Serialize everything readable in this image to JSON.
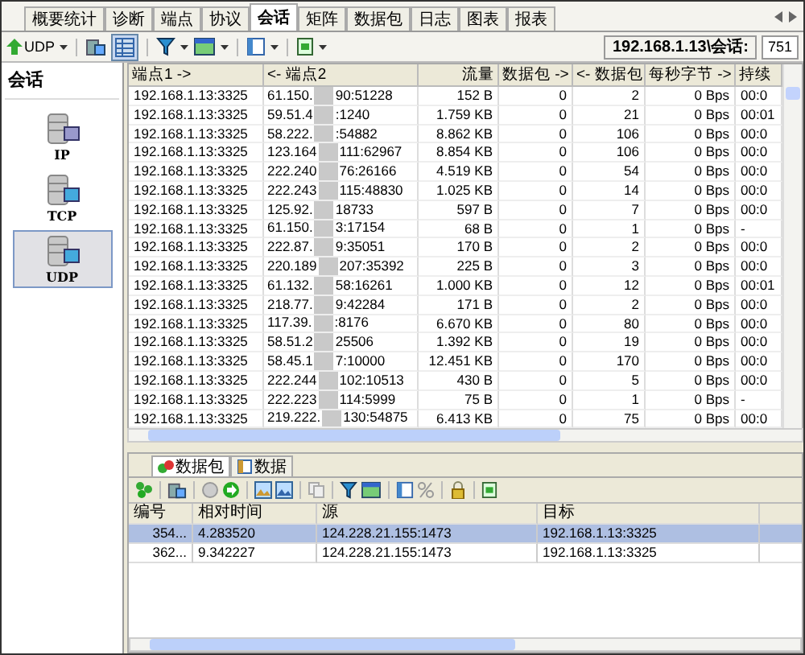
{
  "tabs": [
    {
      "label": "概要统计",
      "selected": false
    },
    {
      "label": "诊断",
      "selected": false
    },
    {
      "label": "端点",
      "selected": false
    },
    {
      "label": "协议",
      "selected": false
    },
    {
      "label": "会话",
      "selected": true
    },
    {
      "label": "矩阵",
      "selected": false
    },
    {
      "label": "数据包",
      "selected": false
    },
    {
      "label": "日志",
      "selected": false
    },
    {
      "label": "图表",
      "selected": false
    },
    {
      "label": "报表",
      "selected": false
    }
  ],
  "toolbar": {
    "protocol_button": "UDP"
  },
  "address": {
    "label": "192.168.1.13\\会话:",
    "count": "751"
  },
  "sidebar": {
    "title": "会话",
    "items": [
      {
        "label": "IP",
        "selected": false
      },
      {
        "label": "TCP",
        "selected": false
      },
      {
        "label": "UDP",
        "selected": true
      }
    ]
  },
  "table": {
    "columns": [
      "端点1 ->",
      "<- 端点2",
      "流量",
      "数据包 ->",
      "<- 数据包",
      "每秒字节 ->",
      "持续"
    ],
    "rows": [
      {
        "a": "192.168.1.13:3325",
        "b1": "61.150.",
        "b2": "90:51228",
        "t": "152 B",
        "po": "0",
        "pi": "2",
        "bps": "0 Bps",
        "d": "00:0"
      },
      {
        "a": "192.168.1.13:3325",
        "b1": "59.51.4",
        "b2": ":1240",
        "t": "1.759 KB",
        "po": "0",
        "pi": "21",
        "bps": "0 Bps",
        "d": "00:01"
      },
      {
        "a": "192.168.1.13:3325",
        "b1": "58.222.",
        "b2": ":54882",
        "t": "8.862 KB",
        "po": "0",
        "pi": "106",
        "bps": "0 Bps",
        "d": "00:0"
      },
      {
        "a": "192.168.1.13:3325",
        "b1": "123.164",
        "b2": "111:62967",
        "t": "8.854 KB",
        "po": "0",
        "pi": "106",
        "bps": "0 Bps",
        "d": "00:0"
      },
      {
        "a": "192.168.1.13:3325",
        "b1": "222.240",
        "b2": "76:26166",
        "t": "4.519 KB",
        "po": "0",
        "pi": "54",
        "bps": "0 Bps",
        "d": "00:0"
      },
      {
        "a": "192.168.1.13:3325",
        "b1": "222.243",
        "b2": "115:48830",
        "t": "1.025 KB",
        "po": "0",
        "pi": "14",
        "bps": "0 Bps",
        "d": "00:0"
      },
      {
        "a": "192.168.1.13:3325",
        "b1": "125.92.",
        "b2": "18733",
        "t": "597 B",
        "po": "0",
        "pi": "7",
        "bps": "0 Bps",
        "d": "00:0"
      },
      {
        "a": "192.168.1.13:3325",
        "b1": "61.150.",
        "b2": "3:17154",
        "t": "68 B",
        "po": "0",
        "pi": "1",
        "bps": "0 Bps",
        "d": "-"
      },
      {
        "a": "192.168.1.13:3325",
        "b1": "222.87.",
        "b2": "9:35051",
        "t": "170 B",
        "po": "0",
        "pi": "2",
        "bps": "0 Bps",
        "d": "00:0"
      },
      {
        "a": "192.168.1.13:3325",
        "b1": "220.189",
        "b2": "207:35392",
        "t": "225 B",
        "po": "0",
        "pi": "3",
        "bps": "0 Bps",
        "d": "00:0"
      },
      {
        "a": "192.168.1.13:3325",
        "b1": "61.132.",
        "b2": "58:16261",
        "t": "1.000 KB",
        "po": "0",
        "pi": "12",
        "bps": "0 Bps",
        "d": "00:01"
      },
      {
        "a": "192.168.1.13:3325",
        "b1": "218.77.",
        "b2": "9:42284",
        "t": "171 B",
        "po": "0",
        "pi": "2",
        "bps": "0 Bps",
        "d": "00:0"
      },
      {
        "a": "192.168.1.13:3325",
        "b1": "117.39.",
        "b2": ":8176",
        "t": "6.670 KB",
        "po": "0",
        "pi": "80",
        "bps": "0 Bps",
        "d": "00:0"
      },
      {
        "a": "192.168.1.13:3325",
        "b1": "58.51.2",
        "b2": "25506",
        "t": "1.392 KB",
        "po": "0",
        "pi": "19",
        "bps": "0 Bps",
        "d": "00:0"
      },
      {
        "a": "192.168.1.13:3325",
        "b1": "58.45.1",
        "b2": "7:10000",
        "t": "12.451 KB",
        "po": "0",
        "pi": "170",
        "bps": "0 Bps",
        "d": "00:0"
      },
      {
        "a": "192.168.1.13:3325",
        "b1": "222.244",
        "b2": "102:10513",
        "t": "430 B",
        "po": "0",
        "pi": "5",
        "bps": "0 Bps",
        "d": "00:0"
      },
      {
        "a": "192.168.1.13:3325",
        "b1": "222.223",
        "b2": "114:5999",
        "t": "75 B",
        "po": "0",
        "pi": "1",
        "bps": "0 Bps",
        "d": "-"
      },
      {
        "a": "192.168.1.13:3325",
        "b1": "219.222.",
        "b2": "130:54875",
        "t": "6.413 KB",
        "po": "0",
        "pi": "75",
        "bps": "0 Bps",
        "d": "00:0"
      }
    ]
  },
  "bottom_tabs": [
    {
      "label": "数据包",
      "selected": true
    },
    {
      "label": "数据",
      "selected": false
    }
  ],
  "packet_table": {
    "columns": [
      "编号",
      "相对时间",
      "源",
      "目标"
    ],
    "rows": [
      {
        "number": "354...",
        "time": "4.283520",
        "source": "124.228.21.155:1473",
        "destination": "192.168.1.13:3325",
        "selected": true
      },
      {
        "number": "362...",
        "time": "9.342227",
        "source": "124.228.21.155:1473",
        "destination": "192.168.1.13:3325",
        "selected": false
      }
    ]
  }
}
